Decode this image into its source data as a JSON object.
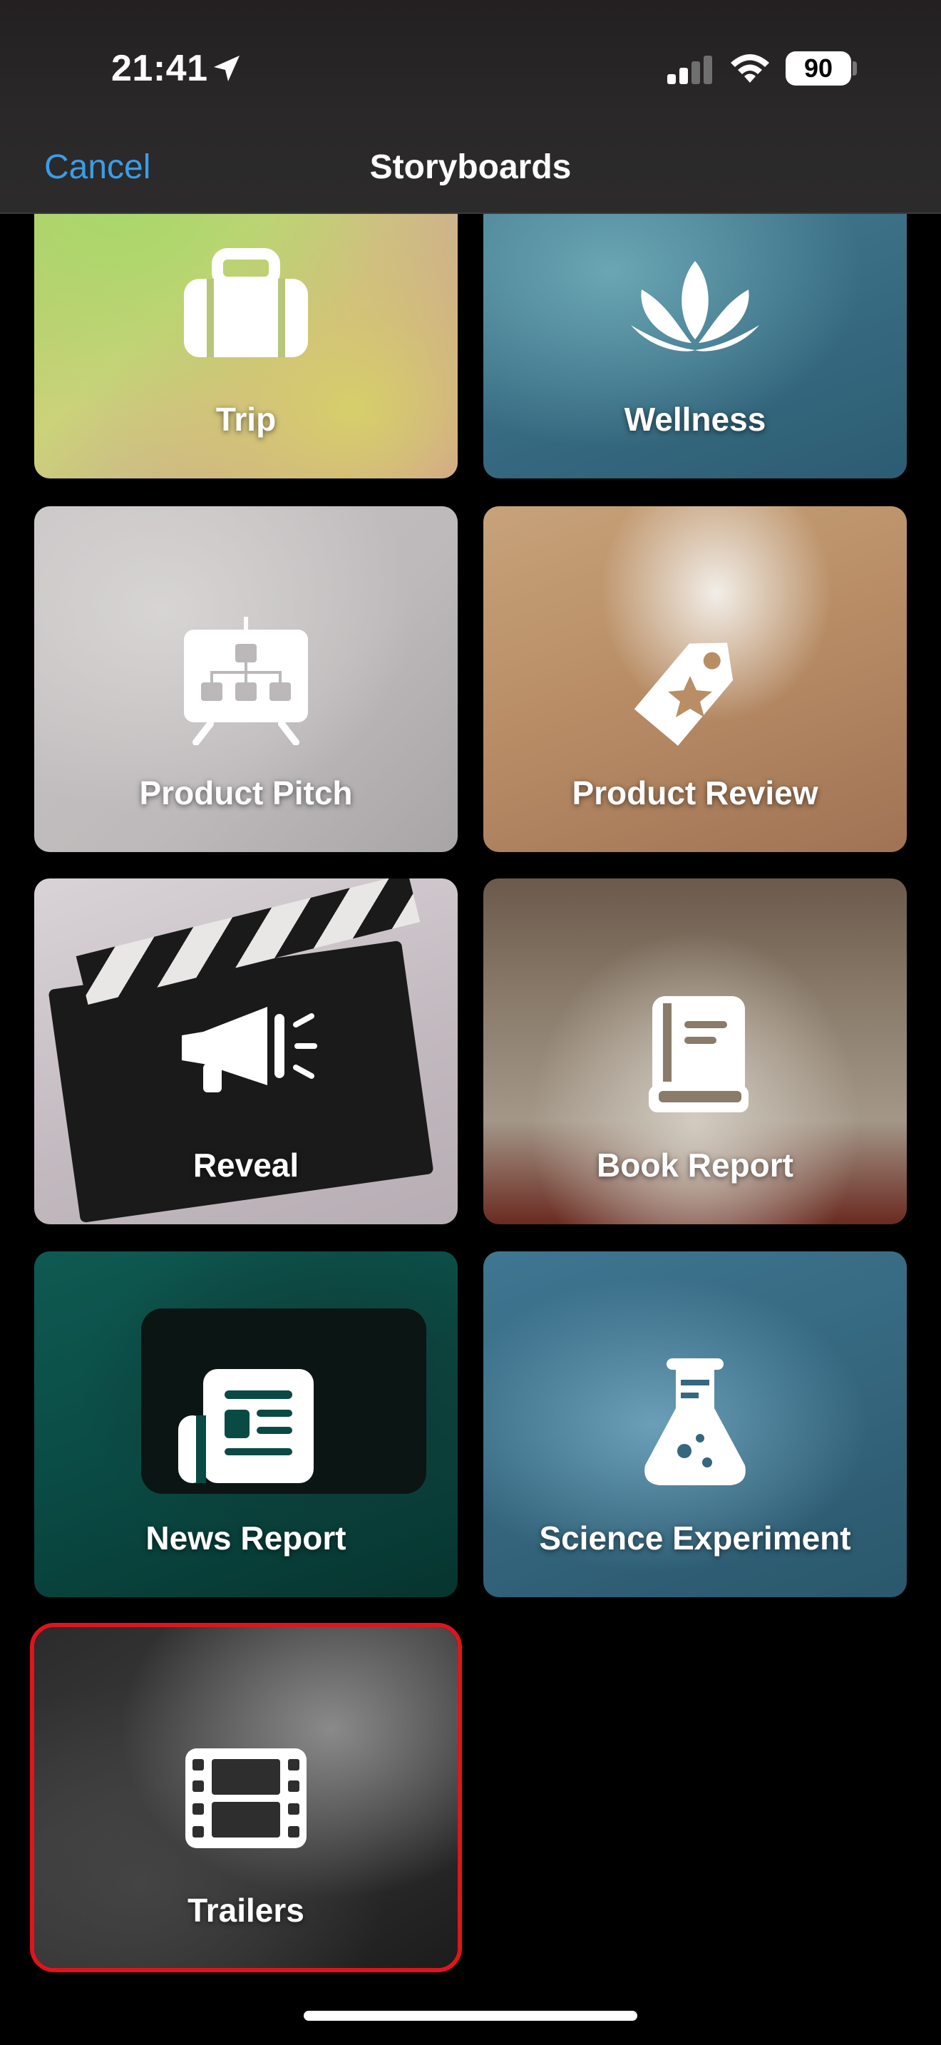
{
  "status_bar": {
    "time": "21:41",
    "battery": "90",
    "icons": [
      "location-arrow-icon",
      "cellular-signal-icon",
      "wifi-icon",
      "battery-icon"
    ]
  },
  "nav": {
    "cancel_label": "Cancel",
    "title": "Storyboards"
  },
  "colors": {
    "accent": "#3a9ee8",
    "highlight_border": "#e0141d",
    "background": "#000000"
  },
  "storyboards": [
    {
      "label": "Trip",
      "icon": "suitcase-icon"
    },
    {
      "label": "Wellness",
      "icon": "lotus-icon"
    },
    {
      "label": "Product Pitch",
      "icon": "presentation-board-icon"
    },
    {
      "label": "Product Review",
      "icon": "price-tag-star-icon"
    },
    {
      "label": "Reveal",
      "icon": "megaphone-icon"
    },
    {
      "label": "Book Report",
      "icon": "book-icon"
    },
    {
      "label": "News Report",
      "icon": "newspaper-icon"
    },
    {
      "label": "Science Experiment",
      "icon": "flask-icon"
    },
    {
      "label": "Trailers",
      "icon": "film-strip-icon",
      "selected": true
    }
  ]
}
